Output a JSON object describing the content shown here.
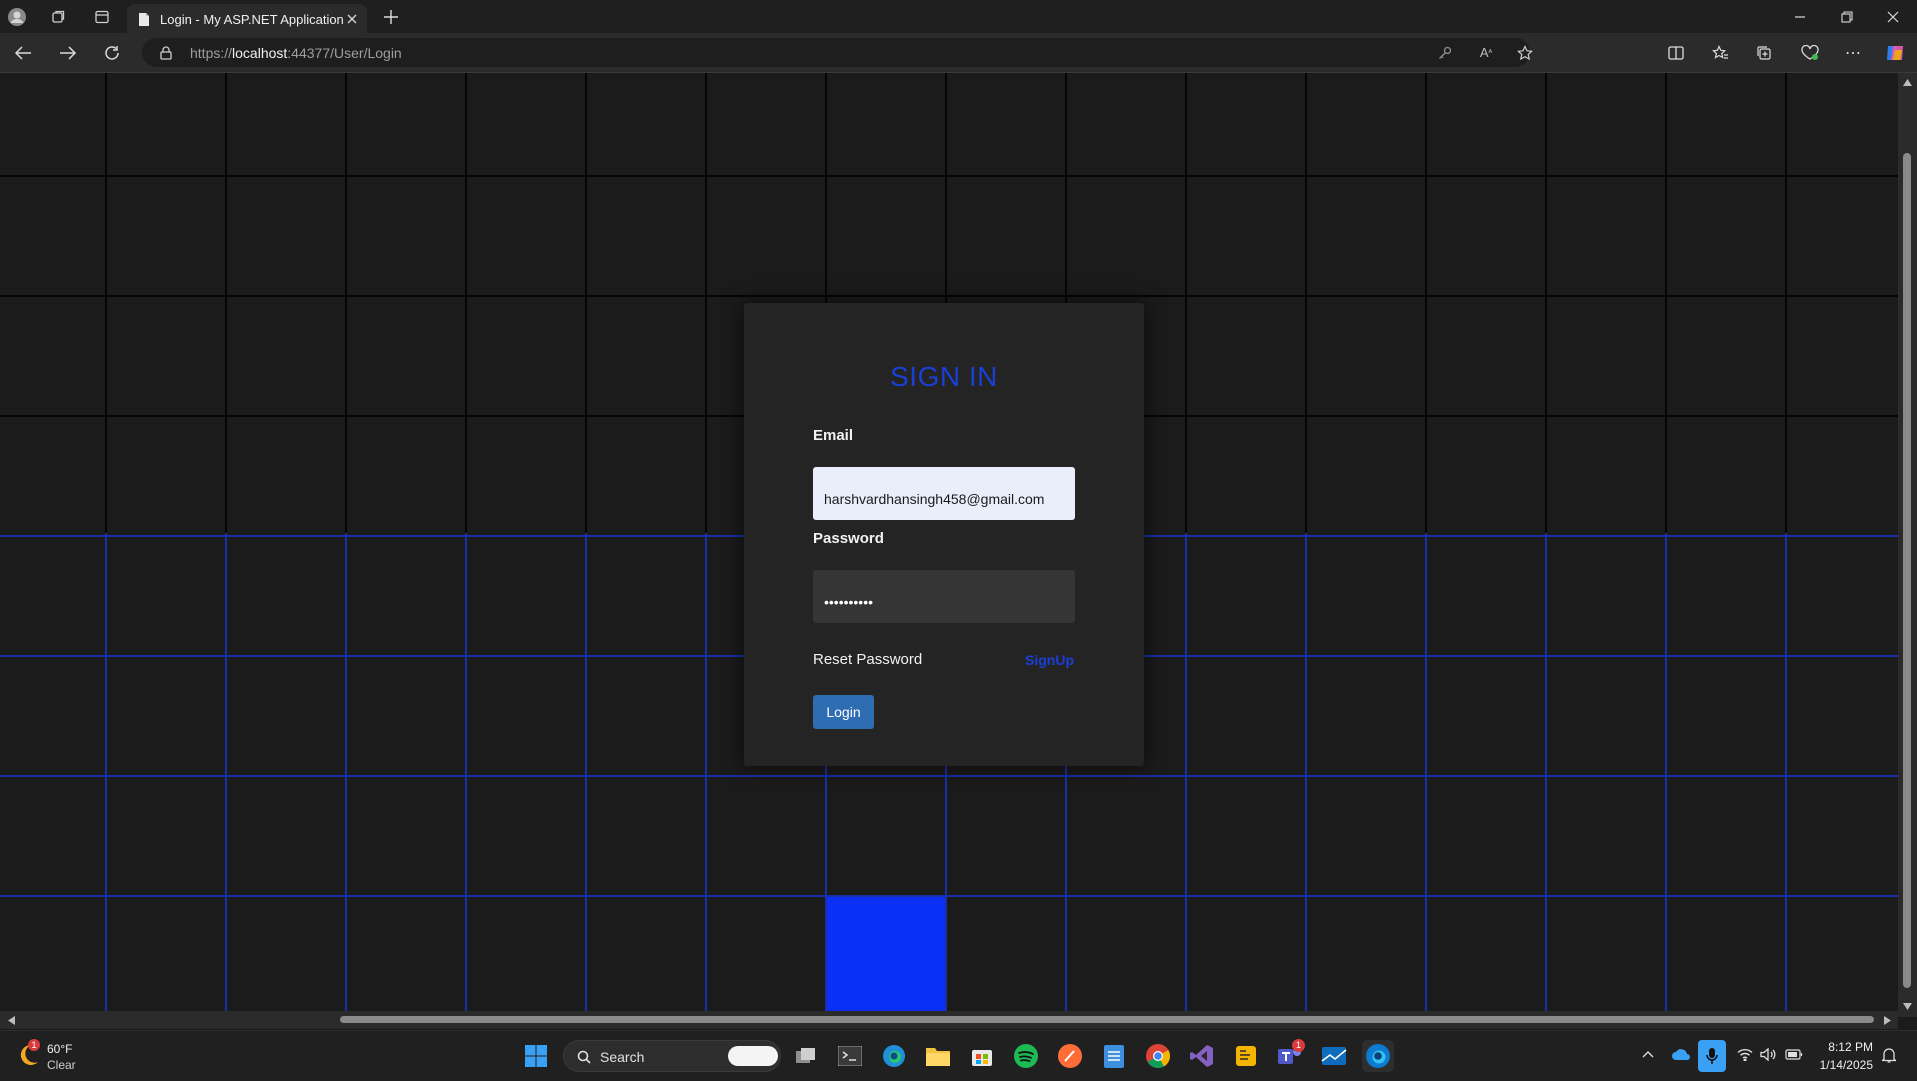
{
  "browser": {
    "tab_title": "Login - My ASP.NET Application",
    "url_prefix": "https://",
    "url_host": "localhost",
    "url_path": ":44377/User/Login"
  },
  "login": {
    "heading": "SIGN IN",
    "email_label": "Email",
    "email_value": "harshvardhansingh458@gmail.com",
    "password_label": "Password",
    "password_value": "••••••••••",
    "reset_label": "Reset Password",
    "signup_label": "SignUp",
    "login_button": "Login"
  },
  "colors": {
    "accent_blue": "#1a3fd6",
    "button_blue": "#2f6db3",
    "highlight_cell": "#0a2ff5"
  },
  "taskbar": {
    "weather_temp": "60°F",
    "weather_condition": "Clear",
    "search_label": "Search",
    "clock_time": "8:12 PM",
    "clock_date": "1/14/2025",
    "notification_badge": "1"
  }
}
